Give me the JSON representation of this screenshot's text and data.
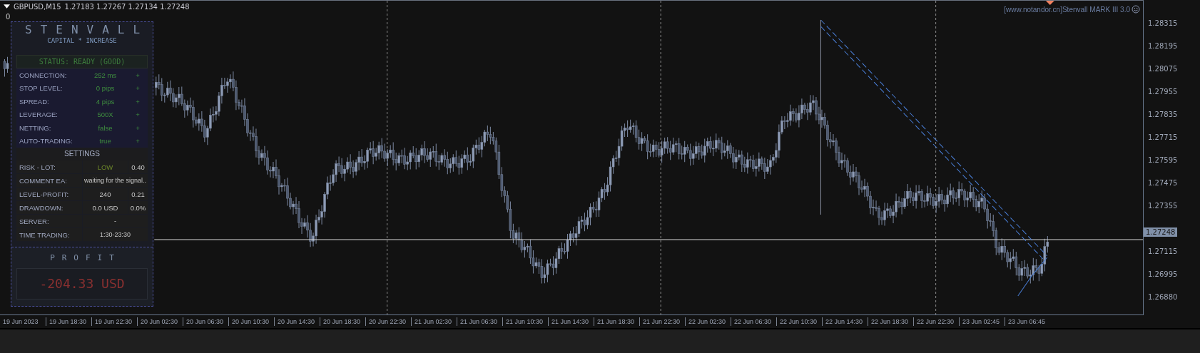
{
  "chart_header": {
    "symbol": "GBPUSD,M15",
    "quotes": "1.27183 1.27267 1.27134 1.27248",
    "subwindow": "0"
  },
  "indicator_label": "[www.notandor.cn]Stenvall MARK III 3.0",
  "panel": {
    "title": "STENVALL",
    "subtitle": "CAPITAL * INCREASE",
    "status": "STATUS: READY (GOOD)",
    "checks": [
      {
        "label": "CONNECTION:",
        "value": "252 ms",
        "mark": "+"
      },
      {
        "label": "STOP LEVEL:",
        "value": "0 pips",
        "mark": "+"
      },
      {
        "label": "SPREAD:",
        "value": "4 pips",
        "mark": "+"
      },
      {
        "label": "LEVERAGE:",
        "value": "500X",
        "mark": "+"
      },
      {
        "label": "NETTING:",
        "value": "false",
        "mark": "+"
      },
      {
        "label": "AUTO-TRADING:",
        "value": "true",
        "mark": "+"
      }
    ],
    "settings_title": "SETTINGS",
    "settings": [
      {
        "kind": "split",
        "label": "RISK - LOT:",
        "value": "LOW",
        "extra": "0.40",
        "highlighted": true
      },
      {
        "kind": "span",
        "label": "COMMENT EA:",
        "value": "waiting for the signal..",
        "highlighted": false
      },
      {
        "kind": "split",
        "label": "LEVEL-PROFIT:",
        "value": "240",
        "extra": "0.21",
        "highlighted": false
      },
      {
        "kind": "split",
        "label": "DRAWDOWN:",
        "value": "0.0 USD",
        "extra": "0.0%",
        "highlighted": false
      },
      {
        "kind": "span",
        "label": "SERVER:",
        "value": "-",
        "highlighted": false
      },
      {
        "kind": "span",
        "label": "TIME TRADING:",
        "value": "1:30-23:30",
        "highlighted": false
      }
    ],
    "profit_title": "PROFIT",
    "profit": "-204.33 USD"
  },
  "price_axis": [
    {
      "kind": "tick",
      "label": "1.28315"
    },
    {
      "kind": "tick",
      "label": "1.28195"
    },
    {
      "kind": "tick",
      "label": "1.28075"
    },
    {
      "kind": "tick",
      "label": "1.27955"
    },
    {
      "kind": "tick",
      "label": "1.27835"
    },
    {
      "kind": "tick",
      "label": "1.27715"
    },
    {
      "kind": "tick",
      "label": "1.27595"
    },
    {
      "kind": "tick",
      "label": "1.27475"
    },
    {
      "kind": "tick",
      "label": "1.27355"
    },
    {
      "kind": "current",
      "label": "1.27248"
    },
    {
      "kind": "tick",
      "label": "1.27115"
    },
    {
      "kind": "tick",
      "label": "1.26995"
    },
    {
      "kind": "tick",
      "label": "1.26880"
    }
  ],
  "time_axis": [
    "19 Jun 2023",
    "19 Jun 18:30",
    "19 Jun 22:30",
    "20 Jun 02:30",
    "20 Jun 06:30",
    "20 Jun 10:30",
    "20 Jun 14:30",
    "20 Jun 18:30",
    "20 Jun 22:30",
    "21 Jun 02:30",
    "21 Jun 06:30",
    "21 Jun 10:30",
    "21 Jun 14:30",
    "21 Jun 18:30",
    "21 Jun 22:30",
    "22 Jun 02:30",
    "22 Jun 06:30",
    "22 Jun 10:30",
    "22 Jun 14:30",
    "22 Jun 18:30",
    "22 Jun 22:30",
    "23 Jun 02:45",
    "23 Jun 06:45"
  ]
}
